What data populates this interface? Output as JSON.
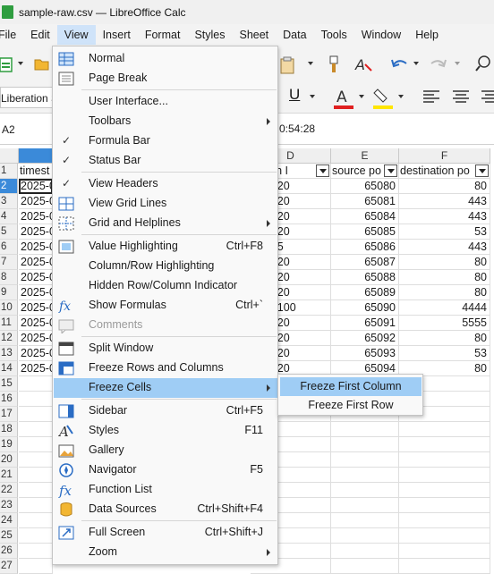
{
  "window": {
    "title": "sample-raw.csv — LibreOffice Calc"
  },
  "menubar": [
    "File",
    "Edit",
    "View",
    "Insert",
    "Format",
    "Styles",
    "Sheet",
    "Data",
    "Tools",
    "Window",
    "Help"
  ],
  "toolbar": {
    "font_name": "Liberation S"
  },
  "formula_bar": {
    "cell_ref": "A2",
    "value_fragment": "0:54:28"
  },
  "grid": {
    "columns": [
      "D",
      "E",
      "F"
    ],
    "header_row": {
      "a": "timest",
      "d": "nation I",
      "e": "source po",
      "f": "destination po"
    },
    "row_numbers": [
      "1",
      "2",
      "3",
      "4",
      "5",
      "6",
      "7",
      "8",
      "9",
      "10",
      "11",
      "12",
      "13",
      "14",
      "15",
      "16",
      "17",
      "18",
      "19",
      "20",
      "21",
      "22",
      "23",
      "24",
      "25",
      "26",
      "27"
    ],
    "rows": [
      {
        "a": "2025-0",
        "d": "68.1.20",
        "e": "65080",
        "f": "80"
      },
      {
        "a": "2025-0",
        "d": "68.1.20",
        "e": "65081",
        "f": "443"
      },
      {
        "a": "2025-0",
        "d": "68.1.20",
        "e": "65084",
        "f": "443"
      },
      {
        "a": "2025-0",
        "d": "68.1.20",
        "e": "65085",
        "f": "53"
      },
      {
        "a": "2025-0",
        "d": "68.1.5",
        "e": "65086",
        "f": "443"
      },
      {
        "a": "2025-0",
        "d": "68.1.20",
        "e": "65087",
        "f": "80"
      },
      {
        "a": "2025-0",
        "d": "68.1.20",
        "e": "65088",
        "f": "80"
      },
      {
        "a": "2025-0",
        "d": "68.1.20",
        "e": "65089",
        "f": "80"
      },
      {
        "a": "2025-0",
        "d": "68.1.100",
        "e": "65090",
        "f": "4444"
      },
      {
        "a": "2025-0",
        "d": "68.1.20",
        "e": "65091",
        "f": "5555"
      },
      {
        "a": "2025-0",
        "d": "68.1.20",
        "e": "65092",
        "f": "80"
      },
      {
        "a": "2025-0",
        "d": "68.1.20",
        "e": "65093",
        "f": "53"
      },
      {
        "a": "2025-0",
        "d": "68.1.20",
        "e": "65094",
        "f": "80"
      }
    ]
  },
  "view_menu": {
    "items": [
      {
        "label": "Normal",
        "shortcut": "",
        "icon": "normal-view-icon"
      },
      {
        "label": "Page Break",
        "shortcut": "",
        "icon": "page-break-icon"
      },
      {
        "label": "User Interface...",
        "shortcut": ""
      },
      {
        "label": "Toolbars",
        "shortcut": "",
        "submenu": true
      },
      {
        "label": "Formula Bar",
        "shortcut": "",
        "checked": true
      },
      {
        "label": "Status Bar",
        "shortcut": "",
        "checked": true
      },
      {
        "label": "View Headers",
        "shortcut": "",
        "checked": true
      },
      {
        "label": "View Grid Lines",
        "shortcut": "",
        "icon": "grid-lines-icon"
      },
      {
        "label": "Grid and Helplines",
        "shortcut": "",
        "submenu": true,
        "icon": "helplines-icon"
      },
      {
        "label": "Value Highlighting",
        "shortcut": "Ctrl+F8",
        "icon": "value-highlighting-icon"
      },
      {
        "label": "Column/Row Highlighting",
        "shortcut": ""
      },
      {
        "label": "Hidden Row/Column Indicator",
        "shortcut": ""
      },
      {
        "label": "Show Formulas",
        "shortcut": "Ctrl+`",
        "icon": "show-formula-icon"
      },
      {
        "label": "Comments",
        "shortcut": "",
        "disabled": true,
        "icon": "comments-icon"
      },
      {
        "label": "Split Window",
        "shortcut": "",
        "icon": "split-window-icon"
      },
      {
        "label": "Freeze Rows and Columns",
        "shortcut": "",
        "icon": "freeze-panes-icon"
      },
      {
        "label": "Freeze Cells",
        "shortcut": "",
        "submenu": true,
        "highlighted": true
      },
      {
        "label": "Sidebar",
        "shortcut": "Ctrl+F5",
        "icon": "sidebar-icon"
      },
      {
        "label": "Styles",
        "shortcut": "F11",
        "icon": "styles-icon"
      },
      {
        "label": "Gallery",
        "shortcut": "",
        "icon": "gallery-icon"
      },
      {
        "label": "Navigator",
        "shortcut": "F5",
        "icon": "navigator-icon"
      },
      {
        "label": "Function List",
        "shortcut": "",
        "icon": "function-list-icon"
      },
      {
        "label": "Data Sources",
        "shortcut": "Ctrl+Shift+F4",
        "icon": "data-sources-icon"
      },
      {
        "label": "Full Screen",
        "shortcut": "Ctrl+Shift+J",
        "icon": "full-screen-icon"
      },
      {
        "label": "Zoom",
        "shortcut": "",
        "submenu": true
      }
    ]
  },
  "freeze_submenu": {
    "items": [
      {
        "label": "Freeze First Column",
        "highlighted": true
      },
      {
        "label": "Freeze First Row"
      }
    ]
  },
  "colors": {
    "accent": "#3b8ad9",
    "menu_highlight": "#9fcdf5",
    "underline_red": "#e02020",
    "highlight_yellow": "#ffe600"
  }
}
